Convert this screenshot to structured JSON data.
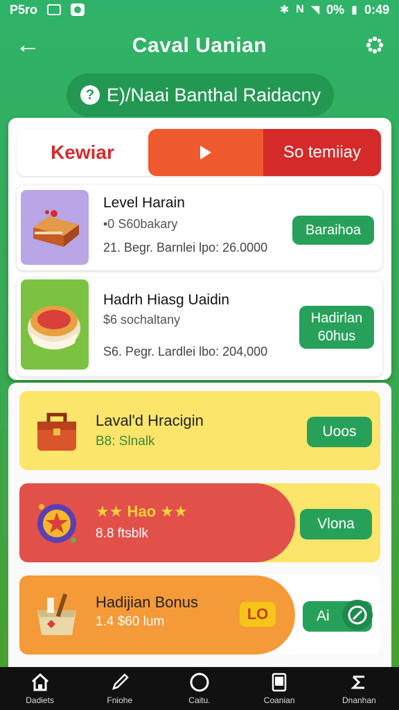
{
  "status": {
    "left_text": "P5ro",
    "battery": "0%",
    "time": "0:49"
  },
  "appbar": {
    "title": "Caval Uanian"
  },
  "pill": {
    "q": "?",
    "text": "E)/Naai Banthal Raidacny"
  },
  "tabs": {
    "left": "Kewiar",
    "right": "So temiiay"
  },
  "rows": [
    {
      "name": "Level Harain",
      "sub": "•0 S60bakary",
      "meta": "21. Begr. Barnlei lpo:  26.0000",
      "button": "Baraihoa"
    },
    {
      "name": "Hadrh Hiasg Uaidin",
      "sub": "$6 sochaltany",
      "meta": "S6. Pegr. Lardlei lbo: 204,000",
      "button": "Hadirlan\n60hus"
    }
  ],
  "promos": [
    {
      "title": "Laval'd Hracigin",
      "sub": "B8: Slnalk",
      "button": "Uoos"
    },
    {
      "title": "★★ Hao ★★",
      "sub": "8.8 ftsblk",
      "button": "Vlona"
    },
    {
      "title": "Hadijian Bonus",
      "sub": "1.4  $60 lum",
      "button": "Ai",
      "badge": "LO"
    }
  ],
  "nav": [
    {
      "label": "Dadiets",
      "icon": "home-icon"
    },
    {
      "label": "Fniohe",
      "icon": "pencil-icon"
    },
    {
      "label": "Caitu.",
      "icon": "circle-icon"
    },
    {
      "label": "Coanian",
      "icon": "tablet-icon"
    },
    {
      "label": "Dnanhan",
      "icon": "menu-icon"
    }
  ],
  "colors": {
    "green": "#27a15a",
    "red": "#d52a2a",
    "orange": "#ee5a2d",
    "yellow": "#fbe56a"
  }
}
